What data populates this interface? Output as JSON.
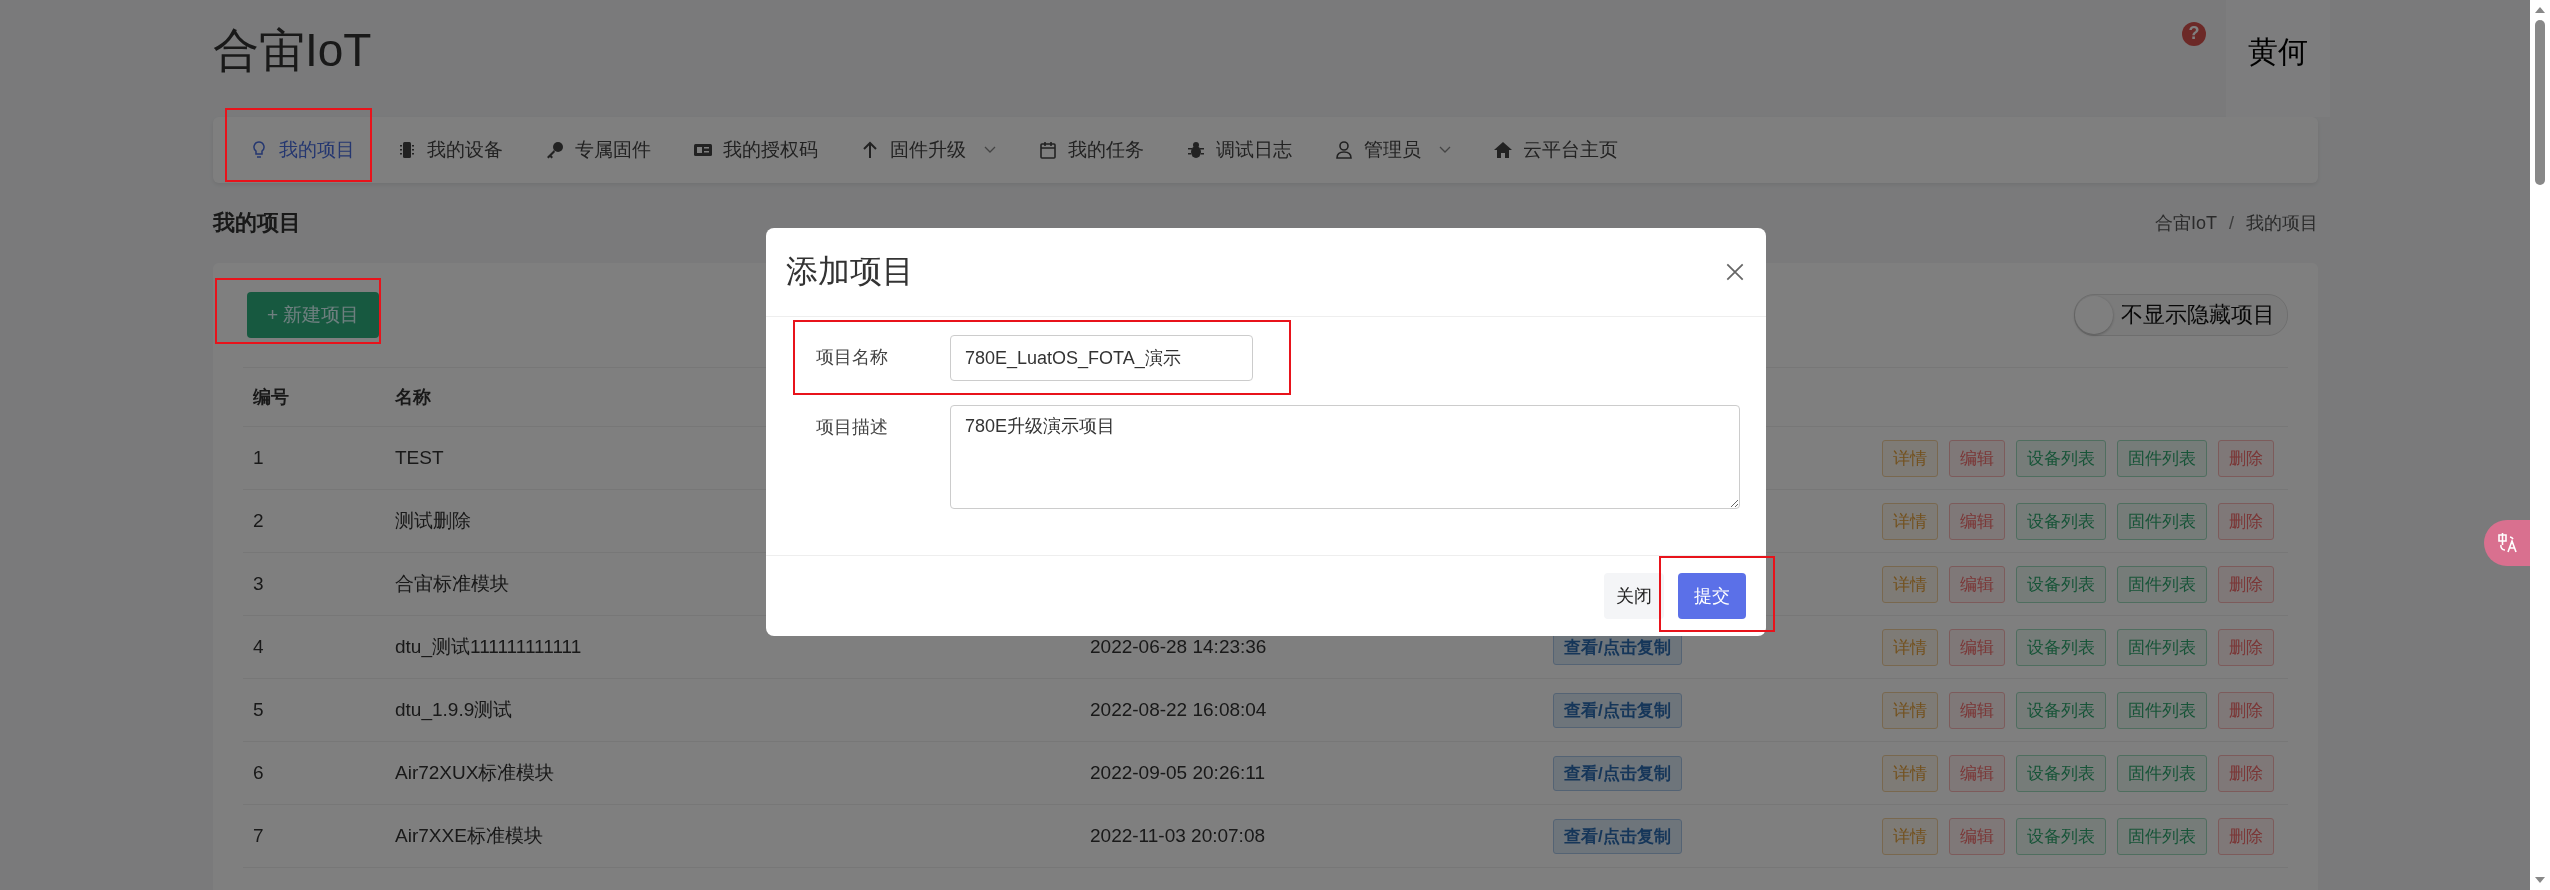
{
  "brand": "合宙IoT",
  "help": "?",
  "user": {
    "name": "黄何"
  },
  "nav": [
    {
      "label": "我的项目",
      "selected": true,
      "dropdown": false
    },
    {
      "label": "我的设备",
      "selected": false,
      "dropdown": false
    },
    {
      "label": "专属固件",
      "selected": false,
      "dropdown": false
    },
    {
      "label": "我的授权码",
      "selected": false,
      "dropdown": false
    },
    {
      "label": "固件升级",
      "selected": false,
      "dropdown": true
    },
    {
      "label": "我的任务",
      "selected": false,
      "dropdown": false
    },
    {
      "label": "调试日志",
      "selected": false,
      "dropdown": false
    },
    {
      "label": "管理员",
      "selected": false,
      "dropdown": true
    },
    {
      "label": "云平台主页",
      "selected": false,
      "dropdown": false
    }
  ],
  "page_title": "我的项目",
  "breadcrumb": {
    "items": [
      "合宙IoT",
      "我的项目"
    ],
    "separator": "/"
  },
  "new_button": "+ 新建项目",
  "toggle": {
    "label": "不显示隐藏项目",
    "on": false
  },
  "table": {
    "columns": [
      "编号",
      "名称"
    ],
    "rows": [
      {
        "cells": [
          "1",
          "TEST"
        ],
        "actions": [
          {
            "label": "详情",
            "kind": "warning"
          },
          {
            "label": "编辑",
            "kind": "danger"
          },
          {
            "label": "设备列表",
            "kind": "success"
          },
          {
            "label": "固件列表",
            "kind": "success"
          },
          {
            "label": "删除",
            "kind": "danger"
          }
        ]
      },
      {
        "cells": [
          "2",
          "测试删除"
        ],
        "actions": [
          {
            "label": "详情",
            "kind": "warning"
          },
          {
            "label": "编辑",
            "kind": "danger"
          },
          {
            "label": "设备列表",
            "kind": "success"
          },
          {
            "label": "固件列表",
            "kind": "success"
          },
          {
            "label": "删除",
            "kind": "danger"
          }
        ]
      },
      {
        "cells": [
          "3",
          "合宙标准模块"
        ],
        "actions": [
          {
            "label": "详情",
            "kind": "warning"
          },
          {
            "label": "编辑",
            "kind": "danger"
          },
          {
            "label": "设备列表",
            "kind": "success"
          },
          {
            "label": "固件列表",
            "kind": "success"
          },
          {
            "label": "删除",
            "kind": "danger"
          }
        ]
      },
      {
        "cells": [
          "4",
          "dtu_测试111111111111",
          "2022-06-28 14:23:36"
        ],
        "key_button": "查看/点击复制",
        "actions": [
          {
            "label": "详情",
            "kind": "warning"
          },
          {
            "label": "编辑",
            "kind": "danger"
          },
          {
            "label": "设备列表",
            "kind": "success"
          },
          {
            "label": "固件列表",
            "kind": "success"
          },
          {
            "label": "删除",
            "kind": "danger"
          }
        ]
      },
      {
        "cells": [
          "5",
          "dtu_1.9.9测试",
          "2022-08-22 16:08:04"
        ],
        "key_button": "查看/点击复制",
        "actions": [
          {
            "label": "详情",
            "kind": "warning"
          },
          {
            "label": "编辑",
            "kind": "danger"
          },
          {
            "label": "设备列表",
            "kind": "success"
          },
          {
            "label": "固件列表",
            "kind": "success"
          },
          {
            "label": "删除",
            "kind": "danger"
          }
        ]
      },
      {
        "cells": [
          "6",
          "Air72XUX标准模块",
          "2022-09-05 20:26:11"
        ],
        "key_button": "查看/点击复制",
        "actions": [
          {
            "label": "详情",
            "kind": "warning"
          },
          {
            "label": "编辑",
            "kind": "danger"
          },
          {
            "label": "设备列表",
            "kind": "success"
          },
          {
            "label": "固件列表",
            "kind": "success"
          },
          {
            "label": "删除",
            "kind": "danger"
          }
        ]
      },
      {
        "cells": [
          "7",
          "Air7XXE标准模块",
          "2022-11-03 20:07:08"
        ],
        "key_button": "查看/点击复制",
        "actions": [
          {
            "label": "详情",
            "kind": "warning"
          },
          {
            "label": "编辑",
            "kind": "danger"
          },
          {
            "label": "设备列表",
            "kind": "success"
          },
          {
            "label": "固件列表",
            "kind": "success"
          },
          {
            "label": "删除",
            "kind": "danger"
          }
        ]
      }
    ]
  },
  "modal": {
    "title": "添加项目",
    "fields": [
      {
        "label": "项目名称",
        "kind": "input",
        "value": "780E_LuatOS_FOTA_演示"
      },
      {
        "label": "项目描述",
        "kind": "textarea",
        "value": "780E升级演示项目"
      }
    ],
    "buttons": [
      {
        "label": "关闭",
        "kind": "secondary"
      },
      {
        "label": "提交",
        "kind": "primary"
      }
    ]
  }
}
